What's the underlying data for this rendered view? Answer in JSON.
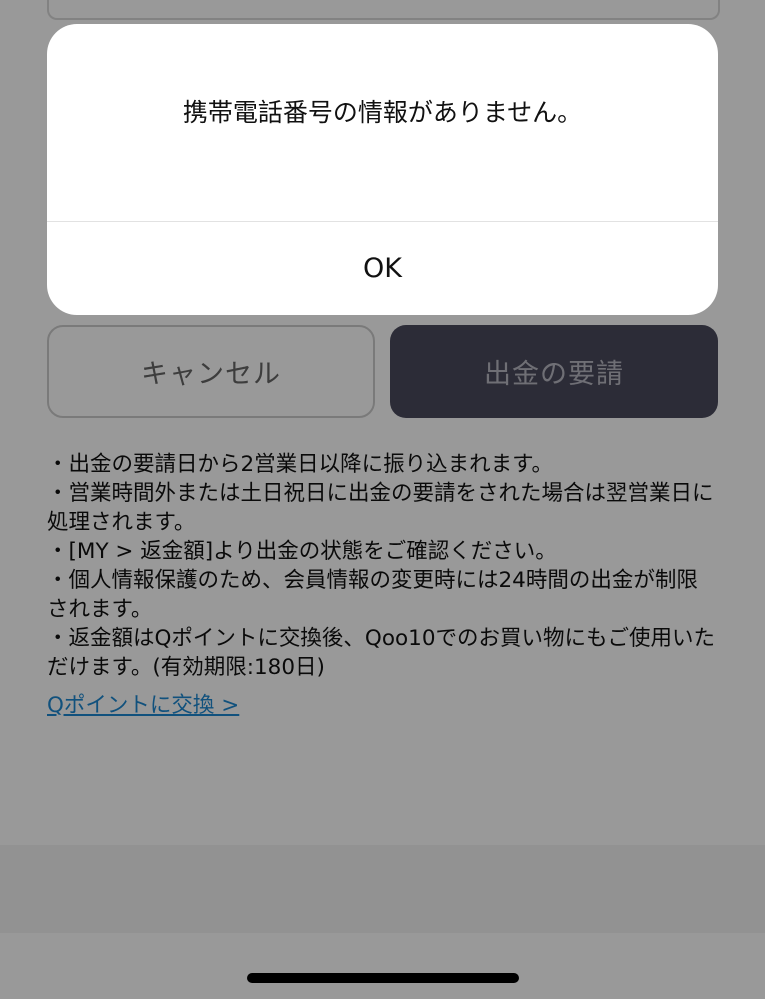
{
  "form": {
    "cancel_label": "キャンセル",
    "request_label": "出金の要請"
  },
  "notes": [
    "・出金の要請日から2営業日以降に振り込まれます。",
    "・営業時間外または土日祝日に出金の要請をされた場合は翌営業日に処理されます。",
    "・[MY > 返金額]より出金の状態をご確認ください。",
    "・個人情報保護のため、会員情報の変更時には24時間の出金が制限されます。",
    "・返金額はQポイントに交換後、Qoo10でのお買い物にもご使用いただけます。(有効期限:180日)"
  ],
  "exchange_link": "Qポイントに交換 >",
  "dialog": {
    "message": "携帯電話番号の情報がありません。",
    "ok_label": "OK"
  },
  "colors": {
    "accent_link": "#1d88d0",
    "request_button": "#4a4a5c",
    "overlay": "rgba(0,0,0,0.40)"
  }
}
